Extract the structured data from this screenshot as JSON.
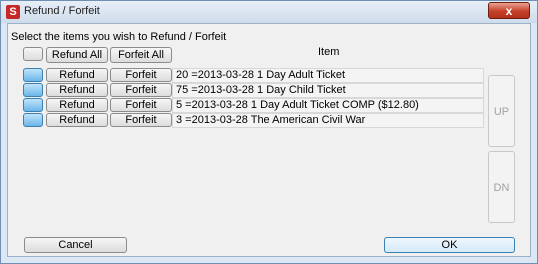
{
  "window": {
    "title": "Refund / Forfeit",
    "icon": "app-logo-icon",
    "close_glyph": "x"
  },
  "instructions": "Select the items you wish to Refund / Forfeit",
  "header": {
    "refund_all_label": "Refund All",
    "forfeit_all_label": "Forfeit All",
    "item_column_label": "Item"
  },
  "rows": [
    {
      "refund_label": "Refund",
      "forfeit_label": "Forfeit",
      "item": "20 =2013-03-28 1 Day Adult Ticket"
    },
    {
      "refund_label": "Refund",
      "forfeit_label": "Forfeit",
      "item": "75 =2013-03-28 1 Day Child Ticket"
    },
    {
      "refund_label": "Refund",
      "forfeit_label": "Forfeit",
      "item": "5 =2013-03-28 1 Day Adult Ticket   COMP ($12.80)"
    },
    {
      "refund_label": "Refund",
      "forfeit_label": "Forfeit",
      "item": "3 =2013-03-28 The American Civil War"
    }
  ],
  "side": {
    "up_label": "UP",
    "dn_label": "DN"
  },
  "footer": {
    "cancel_label": "Cancel",
    "ok_label": "OK"
  }
}
